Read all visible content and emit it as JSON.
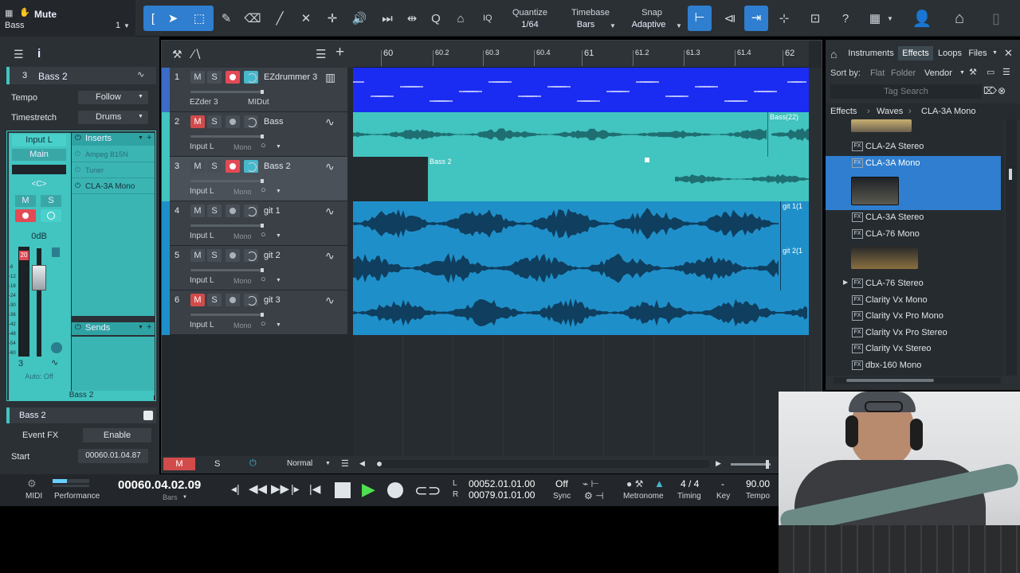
{
  "colors": {
    "accent": "#2f7ecf",
    "mute_red": "#d24b4b",
    "teal": "#42c4c0",
    "clip_blue": "#1f8fc9",
    "ez_blue": "#1b2cf2"
  },
  "toolbar": {
    "mute_title": "Mute",
    "bass_label": "Bass",
    "bass_num": "1",
    "quantize_label": "Quantize",
    "quantize_value": "1/64",
    "timebase_label": "Timebase",
    "timebase_value": "Bars",
    "snap_label": "Snap",
    "snap_value": "Adaptive",
    "iq_label": "IQ"
  },
  "inspector": {
    "track_num": "3",
    "track_name": "Bass 2",
    "tempo_label": "Tempo",
    "tempo_value": "Follow",
    "timestretch_label": "Timestretch",
    "timestretch_value": "Drums",
    "input_label": "Input L",
    "main_label": "Main",
    "pan_label": "<C>",
    "m_label": "M",
    "s_label": "S",
    "db_label": "0dB",
    "fader_top": "20",
    "scale": [
      "-6",
      "-12",
      "-18",
      "-24",
      "-30",
      "-36",
      "-42",
      "-48",
      "-54",
      "-60"
    ],
    "channel_num": "3",
    "auto_label": "Auto: Off",
    "channel_name": "Bass 2",
    "inserts_label": "Inserts",
    "inserts": [
      {
        "name": "Ampeg B15N",
        "on": false
      },
      {
        "name": "Tuner",
        "on": false
      },
      {
        "name": "CLA-3A Mono",
        "on": true
      }
    ],
    "sends_label": "Sends",
    "event_name": "Bass 2",
    "event_fx_label": "Event FX",
    "enable_label": "Enable",
    "start_label": "Start",
    "start_value": "00060.01.04.87"
  },
  "tracks": [
    {
      "num": "1",
      "name": "EZdrummer 3",
      "input": "EZder 3",
      "input2": "MIDut",
      "mono": "",
      "m": false,
      "rec": true,
      "mon": true
    },
    {
      "num": "2",
      "name": "Bass",
      "input": "Input L",
      "input2": "",
      "mono": "Mono",
      "m": true,
      "rec": false,
      "mon": false
    },
    {
      "num": "3",
      "name": "Bass 2",
      "input": "Input L",
      "input2": "",
      "mono": "Mono",
      "m": false,
      "rec": true,
      "mon": true
    },
    {
      "num": "4",
      "name": "git 1",
      "input": "Input L",
      "input2": "",
      "mono": "Mono",
      "m": false,
      "rec": false,
      "mon": false
    },
    {
      "num": "5",
      "name": "git 2",
      "input": "Input L",
      "input2": "",
      "mono": "Mono",
      "m": false,
      "rec": false,
      "mon": false
    },
    {
      "num": "6",
      "name": "git 3",
      "input": "Input L",
      "input2": "",
      "mono": "Mono",
      "m": true,
      "rec": false,
      "mon": false
    }
  ],
  "ruler": [
    "60",
    "60.2",
    "60.3",
    "60.4",
    "61",
    "61.2",
    "61.3",
    "61.4",
    "62"
  ],
  "clips": {
    "bass_end": "Bass(22)",
    "bass2": "Bass 2",
    "git1": "git 1(1",
    "git2": "git 2(1"
  },
  "arrange_footer": {
    "m": "M",
    "s": "S",
    "mode": "Normal"
  },
  "browser": {
    "tabs": [
      "Instruments",
      "Effects",
      "Loops",
      "Files"
    ],
    "active_tab": "Effects",
    "sort_label": "Sort by:",
    "sort_options": [
      "Flat",
      "Folder",
      "Vendor"
    ],
    "search_placeholder": "Tag Search",
    "breadcrumb": [
      "Effects",
      "Waves",
      "CLA-3A Mono"
    ],
    "items": [
      "CLA-2A Stereo",
      "CLA-3A Mono",
      "CLA-3A Stereo",
      "CLA-76 Mono",
      "CLA-76 Stereo",
      "Clarity Vx Mono",
      "Clarity Vx Pro Mono",
      "Clarity Vx Pro Stereo",
      "Clarity Vx Stereo",
      "dbx-160 Mono"
    ],
    "selected": "CLA-3A Mono"
  },
  "transport": {
    "midi_label": "MIDI",
    "perf_label": "Performance",
    "time": "00060.04.02.09",
    "time_unit": "Bars",
    "l_label": "L",
    "r_label": "R",
    "loop_l": "00052.01.01.00",
    "loop_r": "00079.01.01.00",
    "sync_value": "Off",
    "sync_label": "Sync",
    "metronome_label": "Metronome",
    "timing_value": "4 / 4",
    "timing_label": "Timing",
    "key_value": "-",
    "key_label": "Key",
    "tempo_value": "90.00",
    "tempo_label": "Tempo"
  }
}
